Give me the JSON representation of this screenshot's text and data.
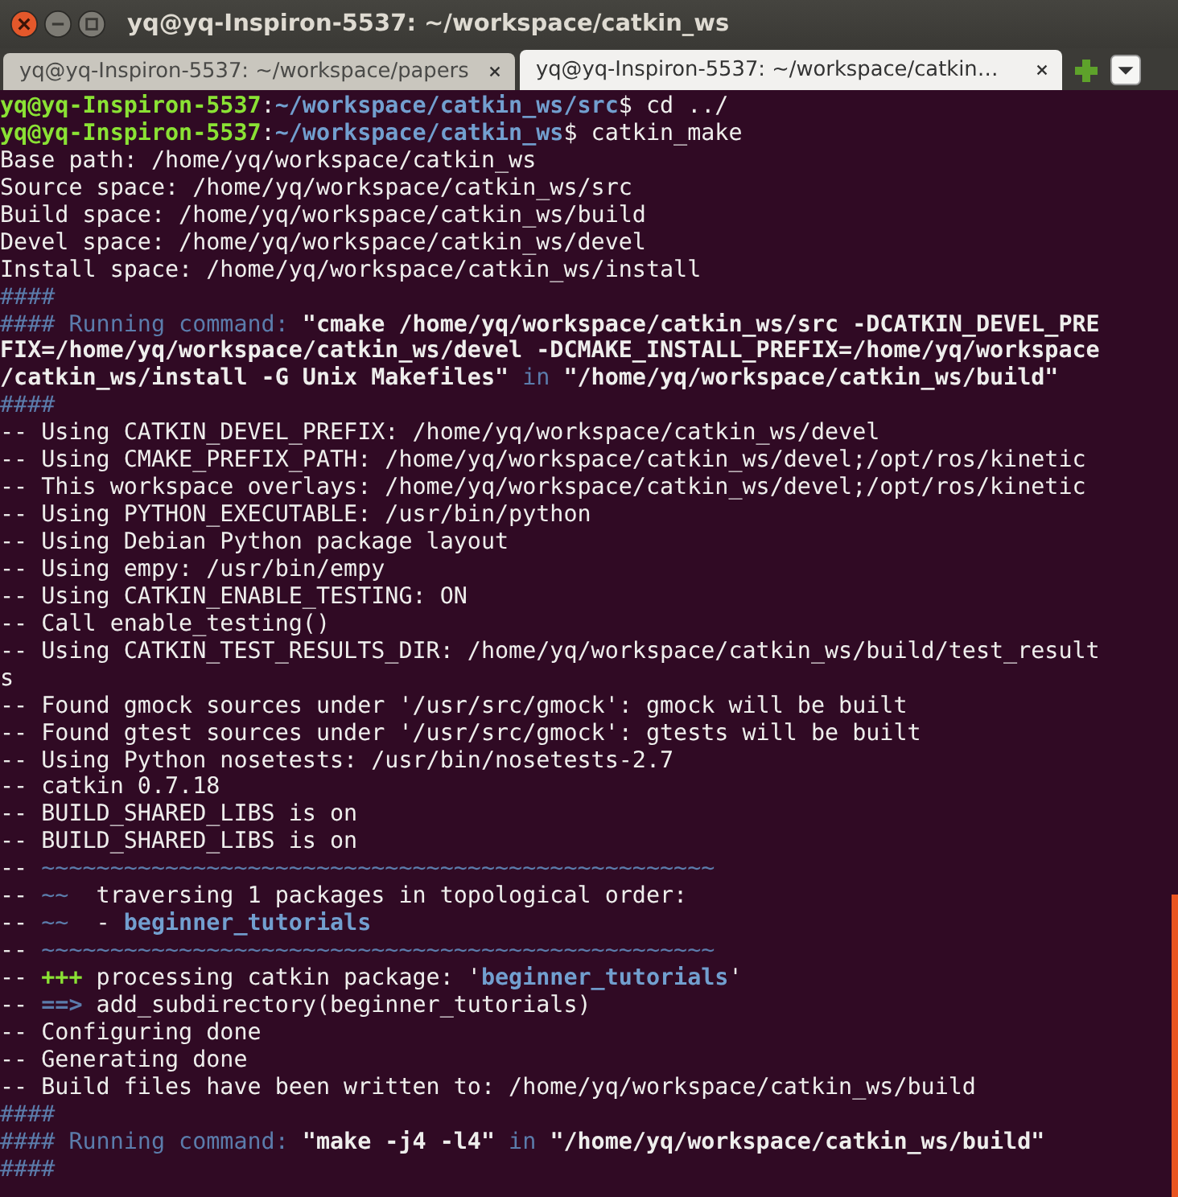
{
  "window": {
    "title": "yq@yq-Inspiron-5537: ~/workspace/catkin_ws"
  },
  "tabs": [
    {
      "label": "yq@yq-Inspiron-5537: ~/workspace/papers",
      "selected": false
    },
    {
      "label": "yq@yq-Inspiron-5537: ~/workspace/catkin…",
      "selected": true
    }
  ],
  "terminal": {
    "lines": [
      {
        "segments": [
          {
            "kind": "user",
            "text": "yq@yq-Inspiron-5537"
          },
          {
            "kind": "plain",
            "text": ":"
          },
          {
            "kind": "path",
            "text": "~/workspace/catkin_ws/src"
          },
          {
            "kind": "plain",
            "text": "$ cd ../"
          }
        ]
      },
      {
        "segments": [
          {
            "kind": "user",
            "text": "yq@yq-Inspiron-5537"
          },
          {
            "kind": "plain",
            "text": ":"
          },
          {
            "kind": "path",
            "text": "~/workspace/catkin_ws"
          },
          {
            "kind": "plain",
            "text": "$ catkin_make"
          }
        ]
      },
      {
        "segments": [
          {
            "kind": "plain",
            "text": "Base path: /home/yq/workspace/catkin_ws"
          }
        ]
      },
      {
        "segments": [
          {
            "kind": "plain",
            "text": "Source space: /home/yq/workspace/catkin_ws/src"
          }
        ]
      },
      {
        "segments": [
          {
            "kind": "plain",
            "text": "Build space: /home/yq/workspace/catkin_ws/build"
          }
        ]
      },
      {
        "segments": [
          {
            "kind": "plain",
            "text": "Devel space: /home/yq/workspace/catkin_ws/devel"
          }
        ]
      },
      {
        "segments": [
          {
            "kind": "plain",
            "text": "Install space: /home/yq/workspace/catkin_ws/install"
          }
        ]
      },
      {
        "segments": [
          {
            "kind": "dim",
            "text": "####"
          }
        ]
      },
      {
        "segments": [
          {
            "kind": "dim",
            "text": "#### Running command: "
          },
          {
            "kind": "bold",
            "text": "\"cmake /home/yq/workspace/catkin_ws/src -DCATKIN_DEVEL_PRE"
          }
        ]
      },
      {
        "segments": [
          {
            "kind": "bold",
            "text": "FIX=/home/yq/workspace/catkin_ws/devel -DCMAKE_INSTALL_PREFIX=/home/yq/workspace"
          }
        ]
      },
      {
        "segments": [
          {
            "kind": "bold",
            "text": "/catkin_ws/install -G Unix Makefiles\""
          },
          {
            "kind": "dim",
            "text": " in "
          },
          {
            "kind": "bold",
            "text": "\"/home/yq/workspace/catkin_ws/build\""
          }
        ]
      },
      {
        "segments": [
          {
            "kind": "dim",
            "text": "####"
          }
        ]
      },
      {
        "segments": [
          {
            "kind": "plain",
            "text": "-- Using CATKIN_DEVEL_PREFIX: /home/yq/workspace/catkin_ws/devel"
          }
        ]
      },
      {
        "segments": [
          {
            "kind": "plain",
            "text": "-- Using CMAKE_PREFIX_PATH: /home/yq/workspace/catkin_ws/devel;/opt/ros/kinetic"
          }
        ]
      },
      {
        "segments": [
          {
            "kind": "plain",
            "text": "-- This workspace overlays: /home/yq/workspace/catkin_ws/devel;/opt/ros/kinetic"
          }
        ]
      },
      {
        "segments": [
          {
            "kind": "plain",
            "text": "-- Using PYTHON_EXECUTABLE: /usr/bin/python"
          }
        ]
      },
      {
        "segments": [
          {
            "kind": "plain",
            "text": "-- Using Debian Python package layout"
          }
        ]
      },
      {
        "segments": [
          {
            "kind": "plain",
            "text": "-- Using empy: /usr/bin/empy"
          }
        ]
      },
      {
        "segments": [
          {
            "kind": "plain",
            "text": "-- Using CATKIN_ENABLE_TESTING: ON"
          }
        ]
      },
      {
        "segments": [
          {
            "kind": "plain",
            "text": "-- Call enable_testing()"
          }
        ]
      },
      {
        "segments": [
          {
            "kind": "plain",
            "text": "-- Using CATKIN_TEST_RESULTS_DIR: /home/yq/workspace/catkin_ws/build/test_result"
          }
        ]
      },
      {
        "segments": [
          {
            "kind": "plain",
            "text": "s"
          }
        ]
      },
      {
        "segments": [
          {
            "kind": "plain",
            "text": "-- Found gmock sources under '/usr/src/gmock': gmock will be built"
          }
        ]
      },
      {
        "segments": [
          {
            "kind": "plain",
            "text": "-- Found gtest sources under '/usr/src/gmock': gtests will be built"
          }
        ]
      },
      {
        "segments": [
          {
            "kind": "plain",
            "text": "-- Using Python nosetests: /usr/bin/nosetests-2.7"
          }
        ]
      },
      {
        "segments": [
          {
            "kind": "plain",
            "text": "-- catkin 0.7.18"
          }
        ]
      },
      {
        "segments": [
          {
            "kind": "plain",
            "text": "-- BUILD_SHARED_LIBS is on"
          }
        ]
      },
      {
        "segments": [
          {
            "kind": "plain",
            "text": "-- BUILD_SHARED_LIBS is on"
          }
        ]
      },
      {
        "segments": [
          {
            "kind": "plain",
            "text": "-- "
          },
          {
            "kind": "dim",
            "text": "~~~~~~~~~~~~~~~~~~~~~~~~~~~~~~~~~~~~~~~~~~~~~~~~~"
          }
        ]
      },
      {
        "segments": [
          {
            "kind": "plain",
            "text": "-- "
          },
          {
            "kind": "dim",
            "text": "~~"
          },
          {
            "kind": "plain",
            "text": "  traversing 1 packages in topological order:"
          }
        ]
      },
      {
        "segments": [
          {
            "kind": "plain",
            "text": "-- "
          },
          {
            "kind": "dim",
            "text": "~~"
          },
          {
            "kind": "plain",
            "text": "  - "
          },
          {
            "kind": "pkg",
            "text": "beginner_tutorials"
          }
        ]
      },
      {
        "segments": [
          {
            "kind": "plain",
            "text": "-- "
          },
          {
            "kind": "dim",
            "text": "~~~~~~~~~~~~~~~~~~~~~~~~~~~~~~~~~~~~~~~~~~~~~~~~~"
          }
        ]
      },
      {
        "segments": [
          {
            "kind": "plain",
            "text": "-- "
          },
          {
            "kind": "add",
            "text": "+++"
          },
          {
            "kind": "plain",
            "text": " processing catkin package: '"
          },
          {
            "kind": "pkg",
            "text": "beginner_tutorials"
          },
          {
            "kind": "plain",
            "text": "'"
          }
        ]
      },
      {
        "segments": [
          {
            "kind": "plain",
            "text": "-- "
          },
          {
            "kind": "arrow",
            "text": "==>"
          },
          {
            "kind": "plain",
            "text": " add_subdirectory(beginner_tutorials)"
          }
        ]
      },
      {
        "segments": [
          {
            "kind": "plain",
            "text": "-- Configuring done"
          }
        ]
      },
      {
        "segments": [
          {
            "kind": "plain",
            "text": "-- Generating done"
          }
        ]
      },
      {
        "segments": [
          {
            "kind": "plain",
            "text": "-- Build files have been written to: /home/yq/workspace/catkin_ws/build"
          }
        ]
      },
      {
        "segments": [
          {
            "kind": "dim",
            "text": "####"
          }
        ]
      },
      {
        "segments": [
          {
            "kind": "dim",
            "text": "#### Running command: "
          },
          {
            "kind": "bold",
            "text": "\"make -j4 -l4\""
          },
          {
            "kind": "dim",
            "text": " in "
          },
          {
            "kind": "bold",
            "text": "\"/home/yq/workspace/catkin_ws/build\""
          }
        ]
      },
      {
        "segments": [
          {
            "kind": "dim",
            "text": "####"
          }
        ]
      }
    ]
  }
}
